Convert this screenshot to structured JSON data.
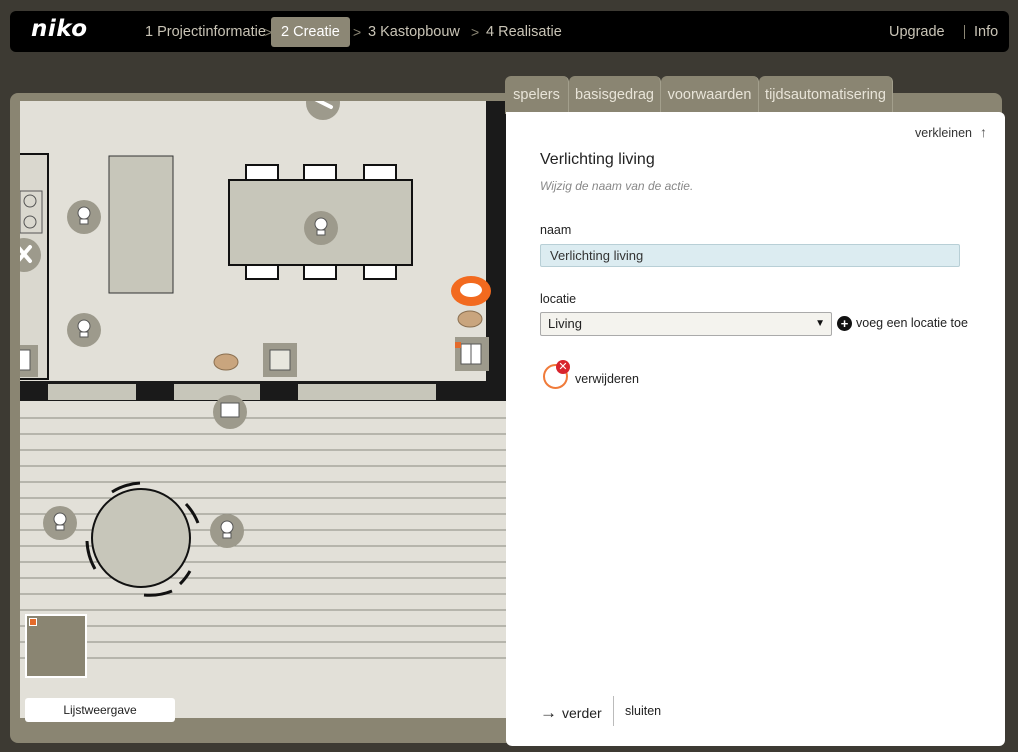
{
  "topbar": {
    "logo": "niko",
    "steps": [
      "1 Projectinformatie",
      "2 Creatie",
      "3 Kastopbouw",
      "4 Realisatie"
    ],
    "active_step": 1,
    "links": {
      "upgrade": "Upgrade",
      "info": "Info"
    }
  },
  "tabs": [
    "spelers",
    "basisgedrag",
    "voorwaarden",
    "tijdsautomatisering"
  ],
  "panel": {
    "shrink_label": "verkleinen",
    "title": "Verlichting living",
    "subtitle": "Wijzig de naam van de actie.",
    "name_label": "naam",
    "name_value": "Verlichting living",
    "location_label": "locatie",
    "location_value": "Living",
    "add_location_label": "voeg een locatie toe",
    "delete_label": "verwijderen",
    "next_label": "verder",
    "close_label": "sluiten"
  },
  "canvas": {
    "list_view_label": "Lijstweergave"
  },
  "colors": {
    "accent_orange": "#e46b2c",
    "delete_red": "#d8242d",
    "active_step_bg": "#8c8775",
    "plan_floor": "#e2e0d8",
    "plan_furniture": "#c7c6ba"
  }
}
